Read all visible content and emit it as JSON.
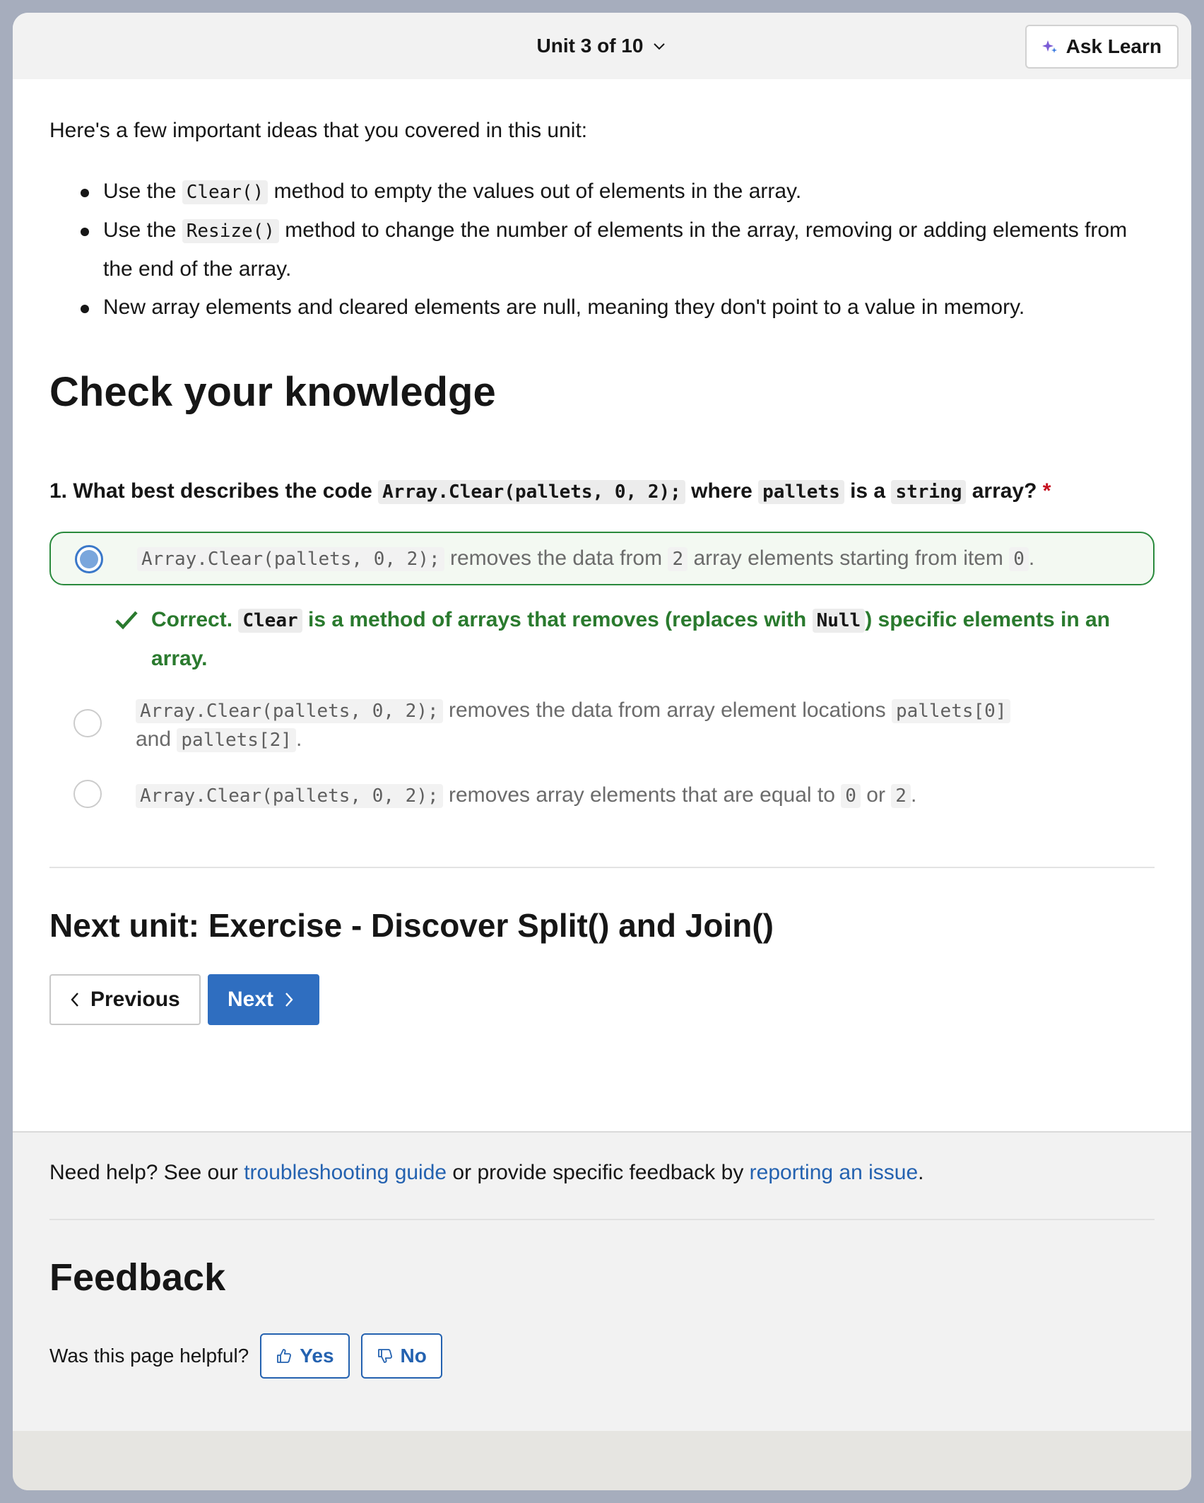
{
  "header": {
    "unit_label": "Unit 3 of 10",
    "ask_learn_label": "Ask Learn"
  },
  "summary": {
    "intro": "Here's a few important ideas that you covered in this unit:",
    "bullets": [
      {
        "pre": "Use the ",
        "code": "Clear()",
        "post": " method to empty the values out of elements in the array."
      },
      {
        "pre": "Use the ",
        "code": "Resize()",
        "post": " method to change the number of elements in the array, removing or adding elements from the end of the array."
      },
      {
        "text": "New array elements and cleared elements are null, meaning they don't point to a value in memory."
      }
    ]
  },
  "knowledge": {
    "heading": "Check your knowledge",
    "question": {
      "prefix": "1. What best describes the code ",
      "code1": "Array.Clear(pallets, 0, 2);",
      "mid1": " where ",
      "code2": "pallets",
      "mid2": " is a ",
      "code3": "string",
      "suffix": " array?",
      "required_mark": "*"
    },
    "options": [
      {
        "code": "Array.Clear(pallets, 0, 2);",
        "text1": " removes the data from ",
        "code2": "2",
        "text2": " array elements starting from item ",
        "code3": "0",
        "text3": ".",
        "selected": true
      },
      {
        "code": "Array.Clear(pallets, 0, 2);",
        "text1": " removes the data from array element locations ",
        "code2": "pallets[0]",
        "text2": " and ",
        "code3": "pallets[2]",
        "text3": ".",
        "selected": false
      },
      {
        "code": "Array.Clear(pallets, 0, 2);",
        "text1": " removes array elements that are equal to ",
        "code2": "0",
        "text2": " or ",
        "code3": "2",
        "text3": ".",
        "selected": false
      }
    ],
    "feedback": {
      "lead": "Correct. ",
      "code1": "Clear",
      "mid": " is a method of arrays that removes (replaces with ",
      "code2": "Null",
      "tail": ") specific elements in an array."
    }
  },
  "next_unit": {
    "heading": "Next unit: Exercise - Discover Split() and Join()",
    "previous_label": "Previous",
    "next_label": "Next"
  },
  "footer": {
    "help_prefix": "Need help? See our ",
    "help_link1": "troubleshooting guide",
    "help_mid": " or provide specific feedback by ",
    "help_link2": "reporting an issue",
    "help_suffix": ".",
    "feedback_heading": "Feedback",
    "helpful_question": "Was this page helpful?",
    "yes_label": "Yes",
    "no_label": "No"
  },
  "colors": {
    "accent": "#2f6ec0",
    "correct": "#2a7a2e",
    "required": "#c50f1f",
    "link": "#2462b0"
  }
}
